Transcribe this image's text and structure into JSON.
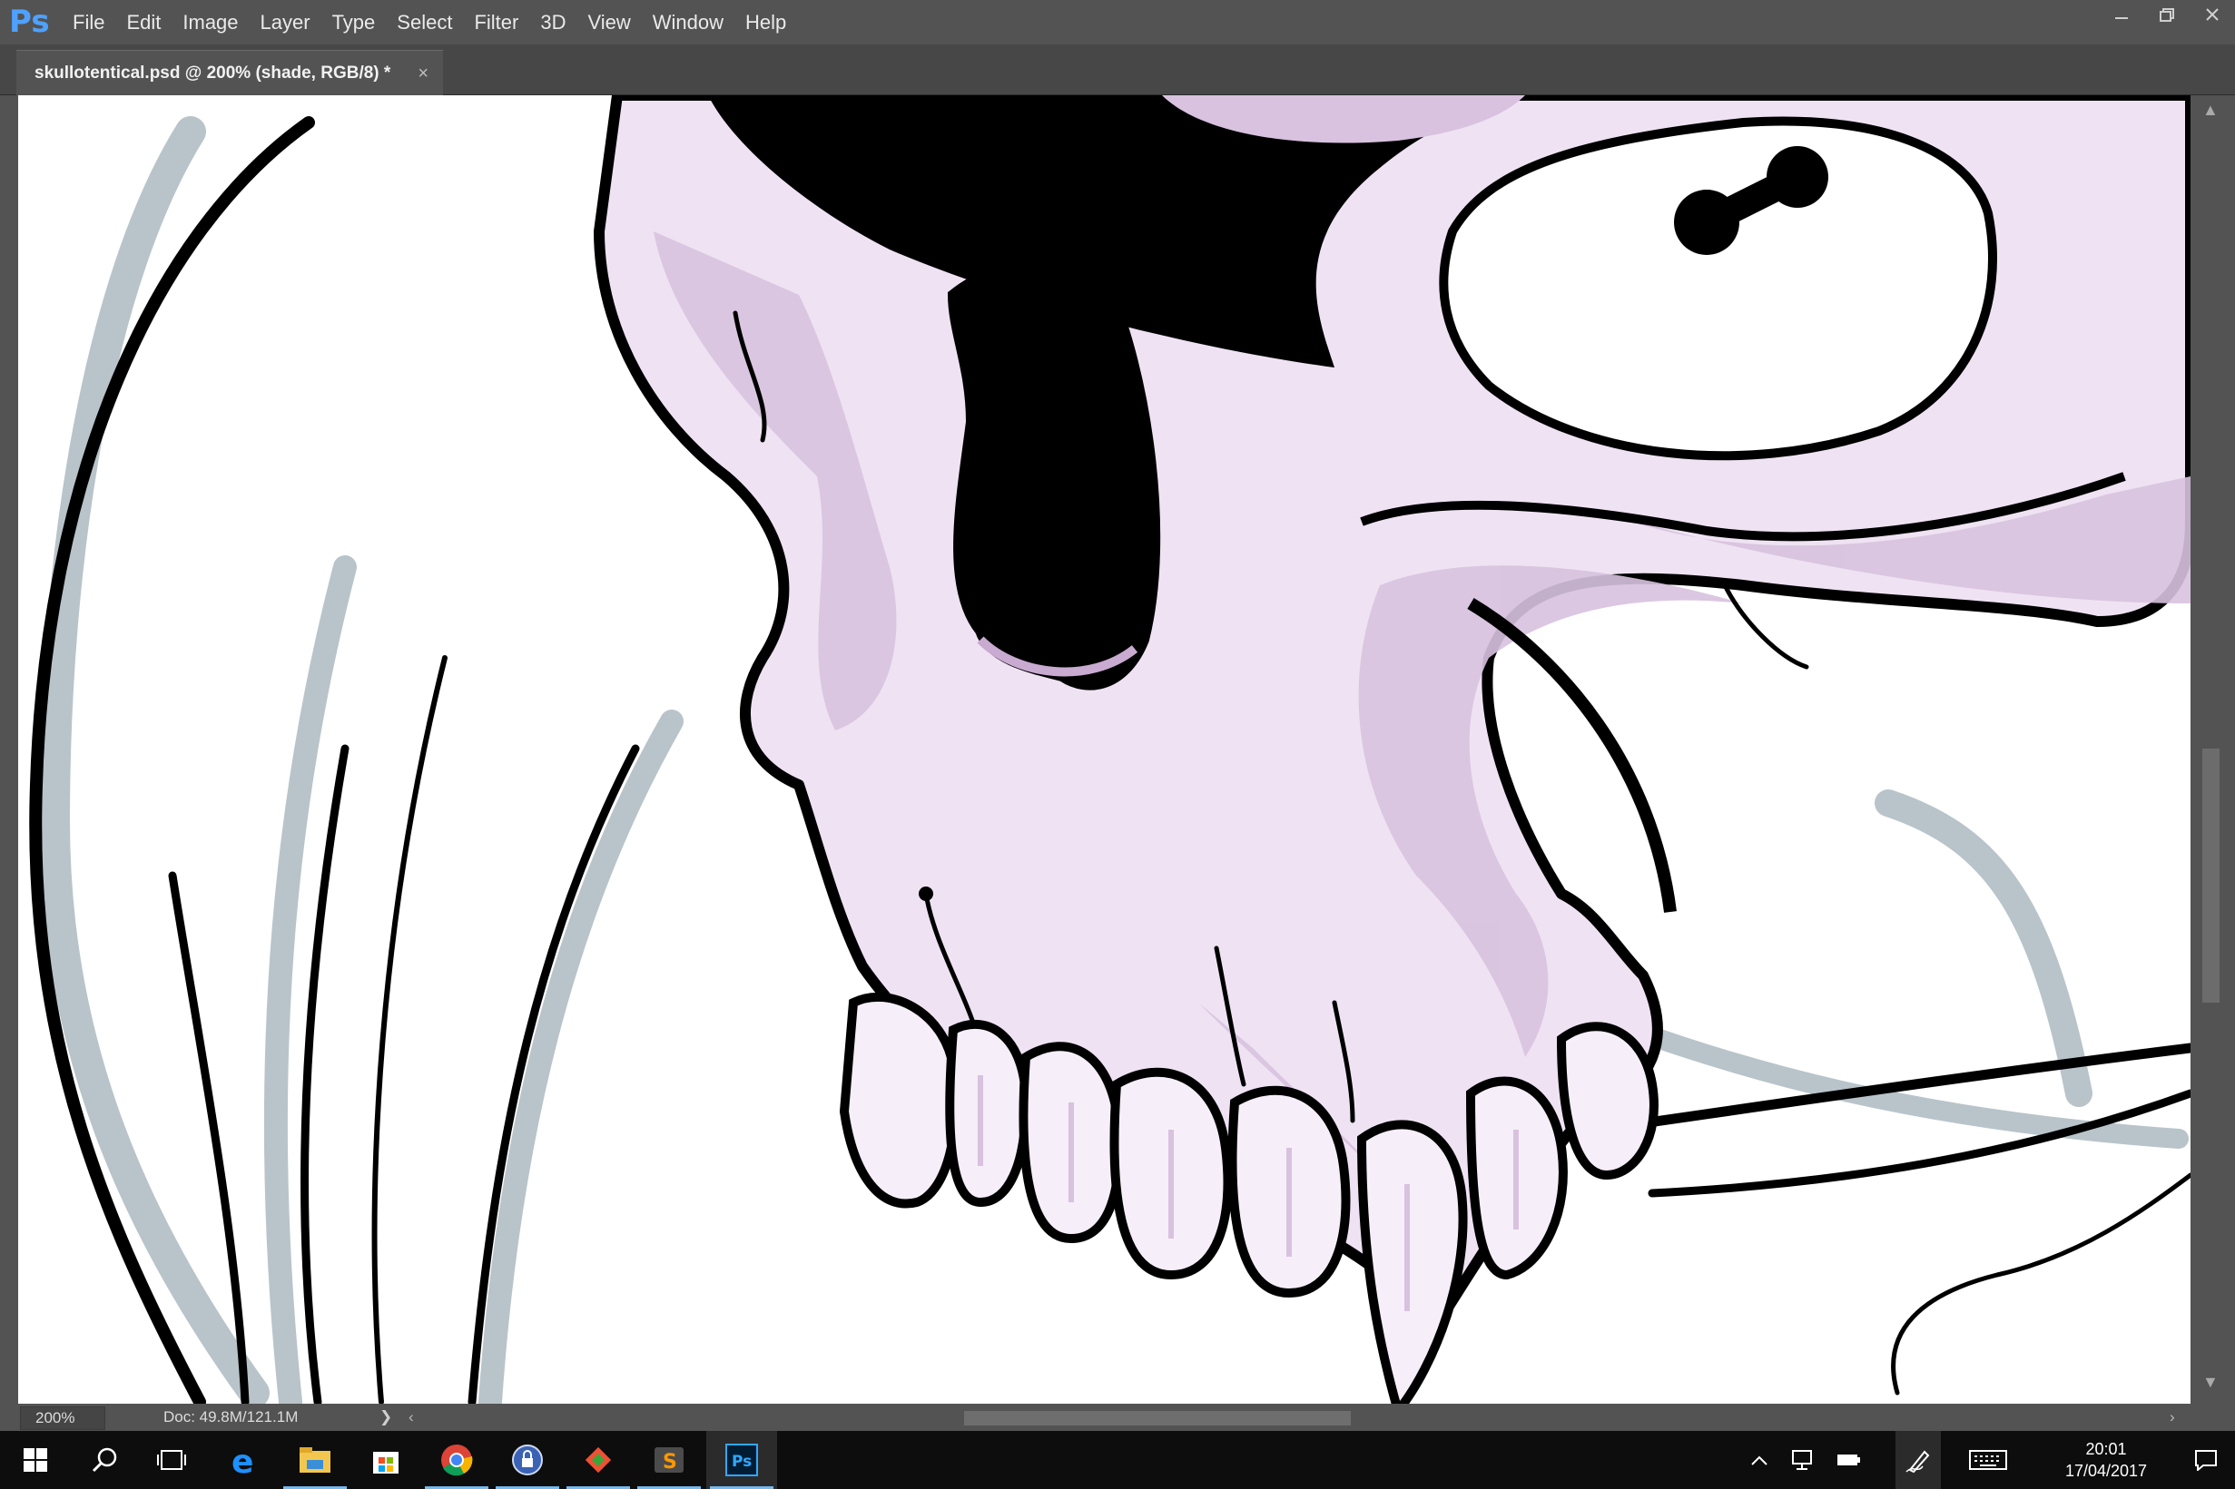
{
  "app": {
    "logo": "Ps",
    "menu": [
      "File",
      "Edit",
      "Image",
      "Layer",
      "Type",
      "Select",
      "Filter",
      "3D",
      "View",
      "Window",
      "Help"
    ],
    "window_controls": [
      "minimize-icon",
      "restore-icon",
      "close-icon"
    ]
  },
  "document_tab": {
    "title": "skullotentical.psd @ 200% (shade, RGB/8) *",
    "close": "×"
  },
  "status": {
    "zoom": "200%",
    "doc_info": "Doc: 49.8M/121.1M",
    "arrow": "❯"
  },
  "taskbar": {
    "icons": [
      "windows-start-icon",
      "search-icon",
      "task-view-icon",
      "edge-icon",
      "file-explorer-icon",
      "store-icon",
      "chrome-icon",
      "keepass-icon",
      "git-icon",
      "sublime-text-icon",
      "photoshop-icon"
    ],
    "tray_icons": [
      "chevron-up-icon",
      "network-icon",
      "battery-icon",
      "pen-icon",
      "keyboard-icon"
    ],
    "time": "20:01",
    "date": "17/04/2017",
    "notification_icon": "action-center-icon"
  },
  "colors": {
    "ui_dark": "#535353",
    "skull_fill": "#efe3f3",
    "skull_shade": "#c9aad0",
    "shadow_grey": "#b7c3c9",
    "ps_blue": "#4ea1ff"
  }
}
